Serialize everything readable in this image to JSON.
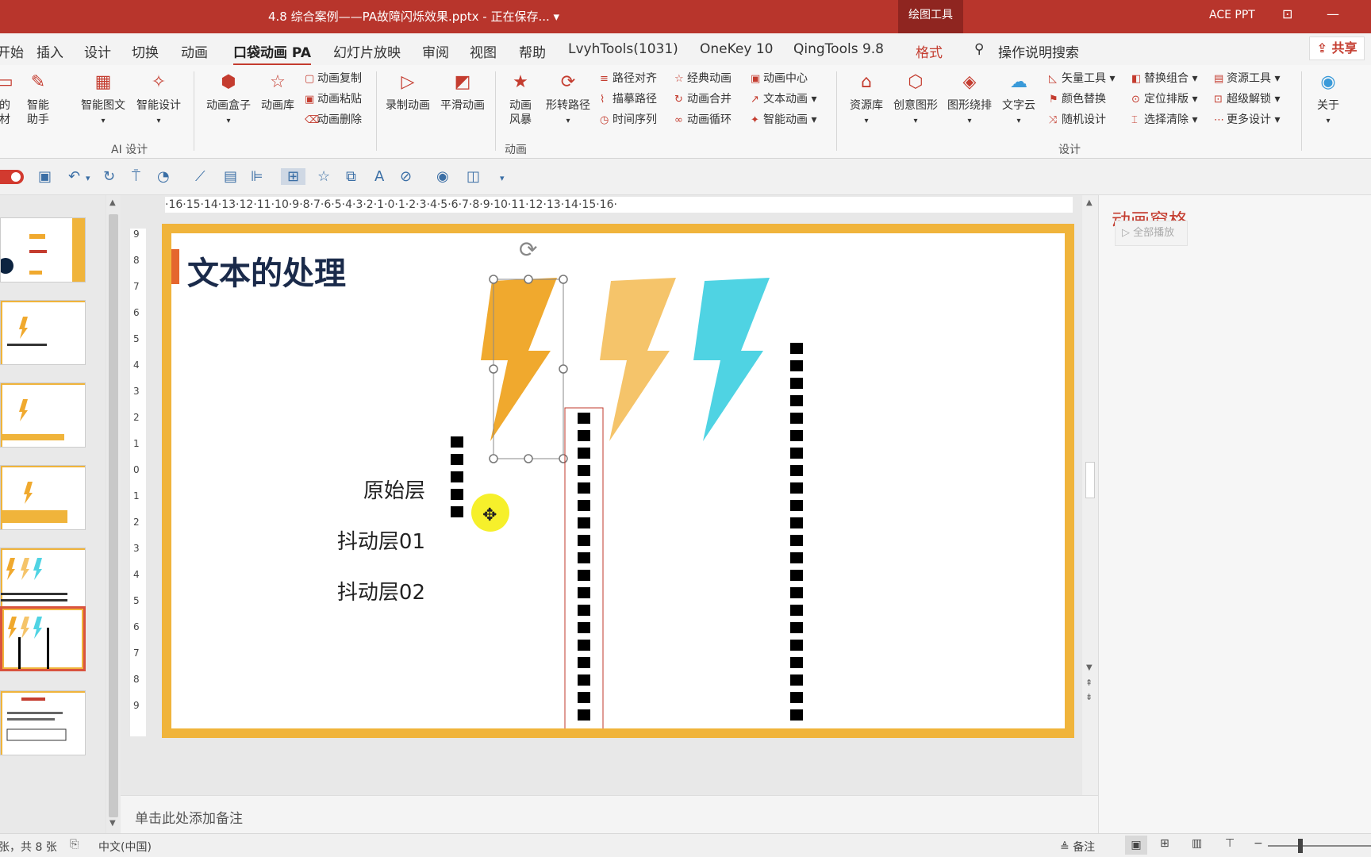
{
  "titlebar": {
    "title": "4.8 综合案例——PA故障闪烁效果.pptx - 正在保存... ▾",
    "context_tab": "绘图工具",
    "user": "ACE PPT"
  },
  "tabs": [
    "开始",
    "插入",
    "设计",
    "切换",
    "动画",
    "口袋动画 PA",
    "幻灯片放映",
    "审阅",
    "视图",
    "帮助",
    "LvyhTools(1031)",
    "OneKey 10",
    "QingTools 9.8",
    "格式"
  ],
  "search_label": "操作说明搜索",
  "share_label": "共享",
  "ribbon": {
    "ai_group": {
      "label": "AI 设计",
      "partial_btn1": "的\n材",
      "buttons": [
        "智能\n助手",
        "智能图文",
        "智能设计"
      ]
    },
    "anim_group": {
      "label": "动画",
      "big": [
        "动画盒子",
        "动画库",
        "录制动画",
        "平滑动画",
        "动画\n风暴",
        "形转路径"
      ],
      "small_col1": [
        "动画复制",
        "动画粘贴",
        "动画删除"
      ],
      "small_col2": [
        "路径对齐",
        "描摹路径",
        "时间序列"
      ],
      "small_col3": [
        "经典动画",
        "动画合并",
        "动画循环"
      ],
      "small_col4": [
        "动画中心",
        "文本动画 ▾",
        "智能动画 ▾"
      ]
    },
    "design_group": {
      "label": "设计",
      "big": [
        "资源库",
        "创意图形",
        "图形绕排",
        "文字云"
      ],
      "small_col1": [
        "矢量工具 ▾",
        "颜色替换",
        "随机设计"
      ],
      "small_col2": [
        "替换组合 ▾",
        "定位排版 ▾",
        "选择清除 ▾"
      ],
      "small_col3": [
        "资源工具 ▾",
        "超级解锁 ▾",
        "更多设计 ▾"
      ]
    },
    "about": "关于"
  },
  "slide": {
    "title": "文本的处理",
    "layers": [
      "原始层",
      "抖动层01",
      "抖动层02"
    ]
  },
  "colors": {
    "accent": "#c43c2f",
    "frame": "#f0b43b",
    "bolt_orange": "#f0a92e",
    "bolt_light": "#f5c46a",
    "bolt_cyan": "#4fd3e3"
  },
  "ruler": {
    "h": "·16·15·14·13·12·11·10·9·8·7·6·5·4·3·2·1·0·1·2·3·4·5·6·7·8·9·10·11·12·13·14·15·16·",
    "v": [
      "9",
      "8",
      "7",
      "6",
      "5",
      "4",
      "3",
      "2",
      "1",
      "0",
      "1",
      "2",
      "3",
      "4",
      "5",
      "6",
      "7",
      "8",
      "9"
    ]
  },
  "anipane": {
    "title": "动画窗格",
    "play_all": "全部播放"
  },
  "notes_placeholder": "单击此处添加备注",
  "status": {
    "slide_info": "张，共 8 张",
    "language": "中文(中国)",
    "notes": "备注"
  }
}
